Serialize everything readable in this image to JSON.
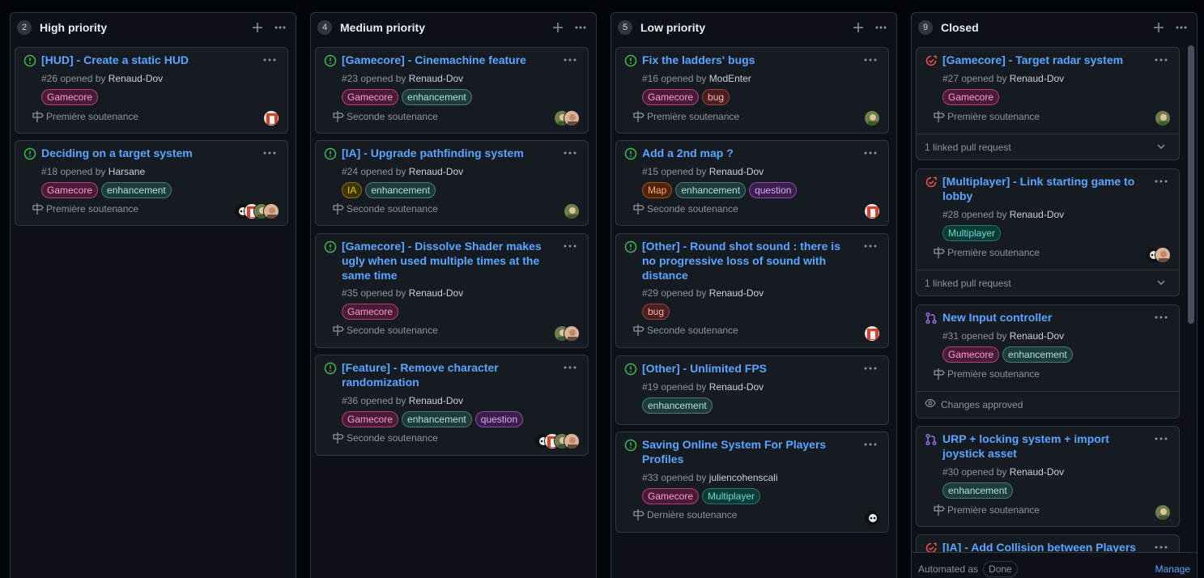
{
  "colors": {
    "open": "#3fb950",
    "closed": "#f85149",
    "merged": "#a371f7",
    "link": "#58a6ff"
  },
  "columns": [
    {
      "count": "2",
      "title": "High priority",
      "cards": [
        {
          "title": "[HUD] - Create a static HUD",
          "number": "#26",
          "opened_by": "opened by",
          "author": "Renaud-Dov",
          "labels": [
            "Gamecore"
          ],
          "milestone": "Première soutenance",
          "avatars": [
            "red"
          ]
        },
        {
          "title": "Deciding on a target system",
          "number": "#18",
          "opened_by": "opened by",
          "author": "Harsane",
          "labels": [
            "Gamecore",
            "enhancement"
          ],
          "milestone": "Première soutenance",
          "avatars": [
            "skull",
            "red",
            "green",
            "face"
          ]
        }
      ]
    },
    {
      "count": "4",
      "title": "Medium priority",
      "cards": [
        {
          "title": "[Gamecore] - Cinemachine feature",
          "number": "#23",
          "opened_by": "opened by",
          "author": "Renaud-Dov",
          "labels": [
            "Gamecore",
            "enhancement"
          ],
          "milestone": "Seconde soutenance",
          "avatars": [
            "green",
            "face"
          ]
        },
        {
          "title": "[IA] - Upgrade pathfinding system",
          "number": "#24",
          "opened_by": "opened by",
          "author": "Renaud-Dov",
          "labels": [
            "IA",
            "enhancement"
          ],
          "milestone": "Seconde soutenance",
          "avatars": [
            "green"
          ]
        },
        {
          "title": "[Gamecore] - Dissolve Shader makes ugly when used multiple times at the same time",
          "number": "#35",
          "opened_by": "opened by",
          "author": "Renaud-Dov",
          "labels": [
            "Gamecore"
          ],
          "milestone": "Seconde soutenance",
          "avatars": [
            "green",
            "face"
          ]
        },
        {
          "title": "[Feature] - Remove character randomization",
          "number": "#36",
          "opened_by": "opened by",
          "author": "Renaud-Dov",
          "labels": [
            "Gamecore",
            "enhancement",
            "question"
          ],
          "milestone": "Seconde soutenance",
          "avatars": [
            "skull",
            "red",
            "green",
            "face"
          ]
        }
      ]
    },
    {
      "count": "5",
      "title": "Low priority",
      "cards": [
        {
          "title": "Fix the ladders' bugs",
          "number": "#16",
          "opened_by": "opened by",
          "author": "ModEnter",
          "labels": [
            "Gamecore",
            "bug"
          ],
          "milestone": "Première soutenance",
          "avatars": [
            "green"
          ]
        },
        {
          "title": "Add a 2nd map ?",
          "number": "#15",
          "opened_by": "opened by",
          "author": "Renaud-Dov",
          "labels": [
            "Map",
            "enhancement",
            "question"
          ],
          "milestone": "Seconde soutenance",
          "avatars": [
            "red"
          ]
        },
        {
          "title": "[Other] - Round shot sound : there is no progressive loss of sound with distance",
          "number": "#29",
          "opened_by": "opened by",
          "author": "Renaud-Dov",
          "labels": [
            "bug"
          ],
          "milestone": "Seconde soutenance",
          "avatars": [
            "red"
          ]
        },
        {
          "title": "[Other] - Unlimited FPS",
          "number": "#19",
          "opened_by": "opened by",
          "author": "Renaud-Dov",
          "labels": [
            "enhancement"
          ],
          "milestone": "",
          "avatars": []
        },
        {
          "title": "Saving Online System For Players Profiles",
          "number": "#33",
          "opened_by": "opened by",
          "author": "juliencohenscali",
          "labels": [
            "Gamecore",
            "Multiplayer"
          ],
          "milestone": "Dernière soutenance",
          "avatars": [
            "skull"
          ]
        }
      ]
    },
    {
      "count": "9",
      "title": "Closed",
      "cards": [
        {
          "title": "[Gamecore] - Target radar system",
          "number": "#27",
          "opened_by": "opened by",
          "author": "Renaud-Dov",
          "labels": [
            "Gamecore"
          ],
          "milestone": "Première soutenance",
          "avatars": [
            "green"
          ],
          "sub": "1 linked pull request"
        },
        {
          "title": "[Multiplayer] - Link starting game to lobby",
          "number": "#28",
          "opened_by": "opened by",
          "author": "Renaud-Dov",
          "labels": [
            "Multiplayer"
          ],
          "milestone": "Première soutenance",
          "avatars": [
            "skull",
            "face"
          ],
          "sub": "1 linked pull request"
        },
        {
          "title": "New Input controller",
          "number": "#31",
          "opened_by": "opened by",
          "author": "Renaud-Dov",
          "labels": [
            "Gamecore",
            "enhancement"
          ],
          "milestone": "Première soutenance",
          "avatars": [],
          "sub": "Changes approved"
        },
        {
          "title": "URP + locking system + import joystick asset",
          "number": "#30",
          "opened_by": "opened by",
          "author": "Renaud-Dov",
          "labels": [
            "enhancement"
          ],
          "milestone": "Première soutenance",
          "avatars": [
            "green"
          ]
        },
        {
          "title": "[IA] - Add Collision between Players",
          "number": "",
          "opened_by": "",
          "author": "",
          "labels": [],
          "milestone": "",
          "avatars": []
        }
      ],
      "footer": {
        "automated": "Automated as",
        "done": "Done",
        "manage": "Manage"
      }
    }
  ]
}
